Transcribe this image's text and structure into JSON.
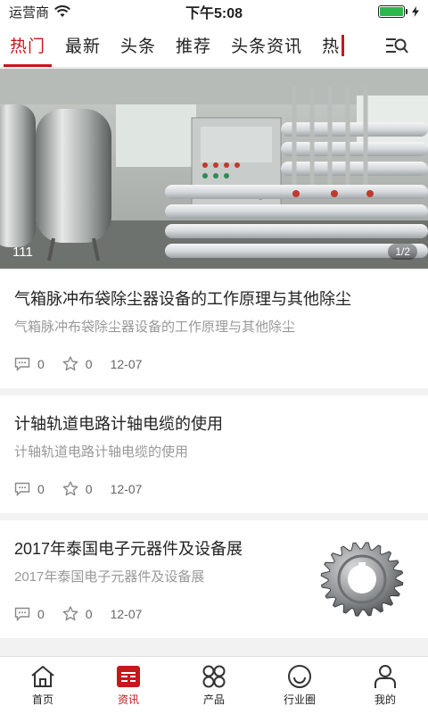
{
  "status_bar": {
    "carrier": "运营商",
    "time": "下午5:08",
    "battery_level": 1.0
  },
  "tabs": {
    "items": [
      "热门",
      "最新",
      "头条",
      "推荐",
      "头条资讯",
      "热"
    ],
    "active_index": 0
  },
  "banner": {
    "caption": "111",
    "pager": "1/2"
  },
  "articles": [
    {
      "title": "气箱脉冲布袋除尘器设备的工作原理与其他除尘",
      "summary": "气箱脉冲布袋除尘器设备的工作原理与其他除尘",
      "comments": "0",
      "favorites": "0",
      "date": "12-07"
    },
    {
      "title": "计轴轨道电路计轴电缆的使用",
      "summary": "计轴轨道电路计轴电缆的使用",
      "comments": "0",
      "favorites": "0",
      "date": "12-07"
    },
    {
      "title": "2017年泰国电子元器件及设备展",
      "summary": "2017年泰国电子元器件及设备展",
      "comments": "0",
      "favorites": "0",
      "date": "12-07"
    }
  ],
  "bottom_nav": {
    "items": [
      "首页",
      "资讯",
      "产品",
      "行业圈",
      "我的"
    ],
    "active_index": 1
  },
  "colors": {
    "accent": "#c8161d",
    "muted_text": "#999999",
    "battery": "#2db84d"
  }
}
